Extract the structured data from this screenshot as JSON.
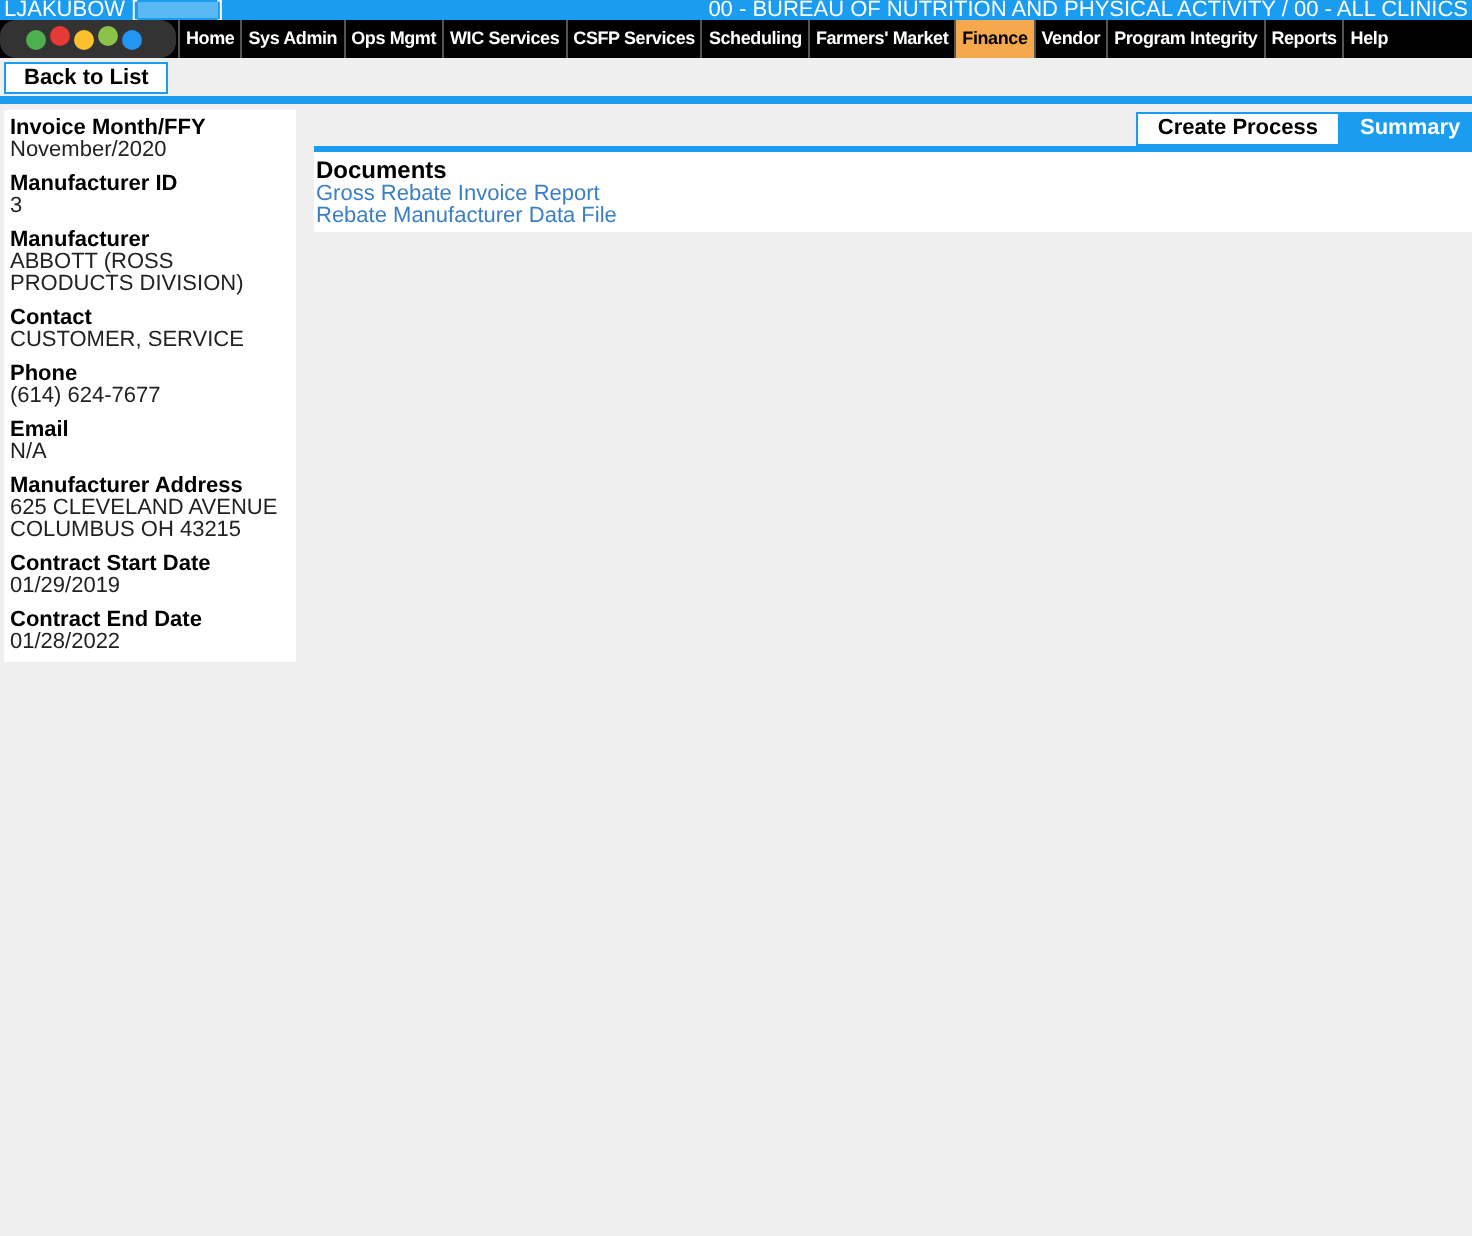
{
  "header": {
    "user": "LJAKUBOW [",
    "user_end": "]",
    "location": "00 - BUREAU OF NUTRITION AND PHYSICAL ACTIVITY / 00 - ALL CLINICS"
  },
  "nav": [
    {
      "label": "Home",
      "selected": false
    },
    {
      "label": "Sys Admin",
      "selected": false
    },
    {
      "label": "Ops Mgmt",
      "selected": false
    },
    {
      "label": "WIC Services",
      "selected": false
    },
    {
      "label": "CSFP Services",
      "selected": false
    },
    {
      "label": "Scheduling",
      "selected": false
    },
    {
      "label": "Farmers' Market",
      "selected": false
    },
    {
      "label": "Finance",
      "selected": true
    },
    {
      "label": "Vendor",
      "selected": false
    },
    {
      "label": "Program Integrity",
      "selected": false
    },
    {
      "label": "Reports",
      "selected": false
    },
    {
      "label": "Help",
      "selected": false
    }
  ],
  "toolbar": {
    "back_button": "Back to List"
  },
  "details": [
    {
      "label": "Invoice Month/FFY",
      "value": "November/2020"
    },
    {
      "label": "Manufacturer ID",
      "value": "3"
    },
    {
      "label": "Manufacturer",
      "value": "ABBOTT (ROSS PRODUCTS DIVISION)"
    },
    {
      "label": "Contact",
      "value": "CUSTOMER, SERVICE"
    },
    {
      "label": "Phone",
      "value": "(614) 624-7677"
    },
    {
      "label": "Email",
      "value": "N/A"
    },
    {
      "label": "Manufacturer Address",
      "value": "625 CLEVELAND AVENUE COLUMBUS OH 43215"
    },
    {
      "label": "Contract Start Date",
      "value": "01/29/2019"
    },
    {
      "label": "Contract End Date",
      "value": "01/28/2022"
    }
  ],
  "tabs": [
    {
      "label": "Create Process",
      "selected": false
    },
    {
      "label": "Summary",
      "selected": true
    }
  ],
  "documents": {
    "title": "Documents",
    "links": [
      "Gross Rebate Invoice Report",
      "Rebate Manufacturer Data File"
    ]
  }
}
